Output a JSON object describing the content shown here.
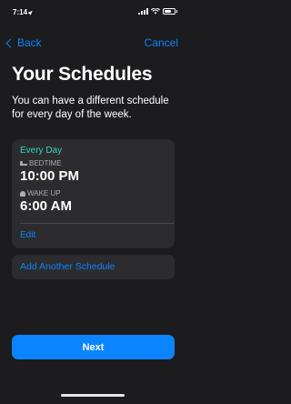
{
  "status_bar": {
    "time": "7:14"
  },
  "nav": {
    "back_label": "Back",
    "cancel_label": "Cancel"
  },
  "header": {
    "title": "Your Schedules",
    "subtitle": "You can have a different schedule for every day of the week."
  },
  "schedule": {
    "day": "Every Day",
    "bedtime_label": "BEDTIME",
    "bedtime": "10:00 PM",
    "wakeup_label": "WAKE UP",
    "wakeup": "6:00 AM",
    "edit_label": "Edit"
  },
  "add_schedule_label": "Add Another Schedule",
  "next_label": "Next",
  "colors": {
    "accent": "#0a84ff",
    "day_teal": "#30d5c8",
    "background": "#1c1c1e",
    "card": "#2c2c2e"
  },
  "icons": [
    "location-arrow-icon",
    "signal-icon",
    "wifi-icon",
    "battery-icon",
    "chevron-left-icon",
    "bed-icon",
    "bell-icon"
  ]
}
